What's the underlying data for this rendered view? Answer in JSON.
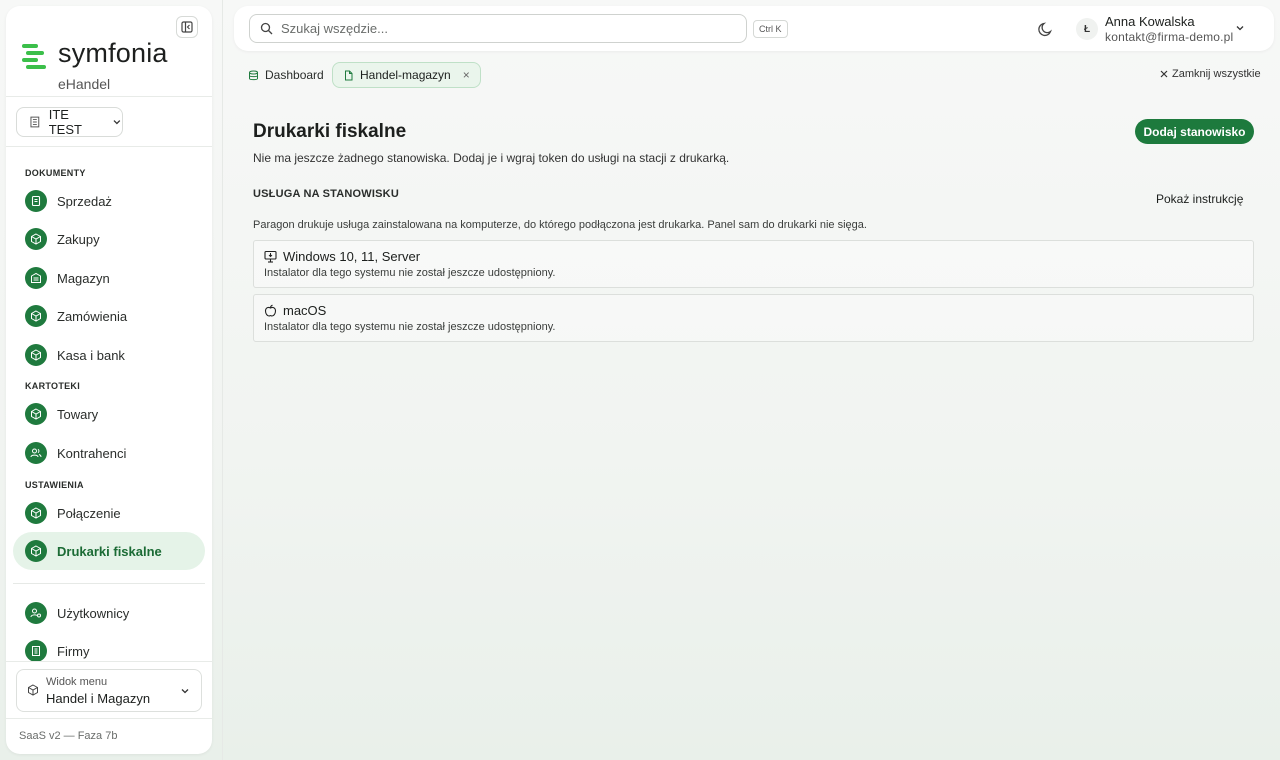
{
  "brand": {
    "name": "symfonia",
    "sub": "eHandel",
    "color": "#1f7a3e",
    "accent": "#3bbf4a"
  },
  "company": {
    "label": "ITE TEST"
  },
  "sidebar": {
    "sections": {
      "dokumenty": "DOKUMENTY",
      "kartoteki": "KARTOTEKI",
      "ustawienia": "USTAWIENIA"
    },
    "items": [
      {
        "label": "Sprzedaż",
        "icon": "document-icon"
      },
      {
        "label": "Zakupy",
        "icon": "box-icon"
      },
      {
        "label": "Magazyn",
        "icon": "warehouse-icon"
      },
      {
        "label": "Zamówienia",
        "icon": "box-icon"
      },
      {
        "label": "Kasa i bank",
        "icon": "box-icon"
      },
      {
        "label": "Towary",
        "icon": "box-icon"
      },
      {
        "label": "Kontrahenci",
        "icon": "users-icon"
      },
      {
        "label": "Połączenie",
        "icon": "box-icon"
      },
      {
        "label": "Drukarki fiskalne",
        "icon": "box-icon",
        "active": true
      },
      {
        "label": "Użytkownicy",
        "icon": "user-key-icon"
      },
      {
        "label": "Firmy",
        "icon": "building-icon"
      }
    ],
    "menu_view": {
      "label": "Widok menu",
      "value": "Handel i Magazyn"
    },
    "version": "SaaS v2 — Faza 7b"
  },
  "topbar": {
    "search_placeholder": "Szukaj wszędzie...",
    "shortcut": "Ctrl K",
    "user": {
      "initial": "Ł",
      "name": "Anna Kowalska",
      "email": "kontakt@firma-demo.pl"
    }
  },
  "tabs": [
    {
      "label": "Dashboard",
      "icon": "database-icon"
    },
    {
      "label": "Handel-magazyn",
      "icon": "file-icon",
      "active": true,
      "close": "×"
    }
  ],
  "close_all": "Zamknij wszystkie",
  "main": {
    "title": "Drukarki fiskalne",
    "subtitle": "Nie ma jeszcze żadnego stanowiska. Dodaj je i wgraj token do usługi na stacji z drukarką.",
    "add_button": "Dodaj stanowisko",
    "section": "USŁUGA NA STANOWISKU",
    "instructions": "Pokaż instrukcję",
    "description": "Paragon drukuje usługa zainstalowana na komputerze, do którego podłączona jest drukarka. Panel sam do drukarki nie sięga.",
    "systems": [
      {
        "name": "Windows 10, 11, Server",
        "note": "Instalator dla tego systemu nie został jeszcze udostępniony.",
        "icon": "monitor-icon"
      },
      {
        "name": "macOS",
        "note": "Instalator dla tego systemu nie został jeszcze udostępniony.",
        "icon": "apple-icon"
      }
    ]
  }
}
